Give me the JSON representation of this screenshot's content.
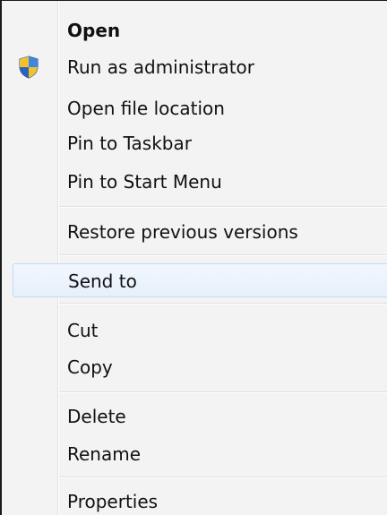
{
  "context_menu": {
    "items": [
      {
        "label": "Open"
      },
      {
        "label": "Run as administrator",
        "icon": "uac-shield-icon"
      },
      {
        "label": "Open file location"
      },
      {
        "label": "Pin to Taskbar"
      },
      {
        "label": "Pin to Start Menu"
      },
      {
        "label": "Restore previous versions"
      },
      {
        "label": "Send to"
      },
      {
        "label": "Cut"
      },
      {
        "label": "Copy"
      },
      {
        "label": "Delete"
      },
      {
        "label": "Rename"
      },
      {
        "label": "Properties"
      }
    ],
    "default_item": "Open",
    "highlighted_item": "Send to",
    "colors": {
      "menu_background": "#f3f3f3",
      "highlight_border": "#c5daf1",
      "highlight_fill": "#e6f0fb",
      "shield_blue": "#2f6fc8",
      "shield_yellow": "#f2c12e"
    }
  }
}
